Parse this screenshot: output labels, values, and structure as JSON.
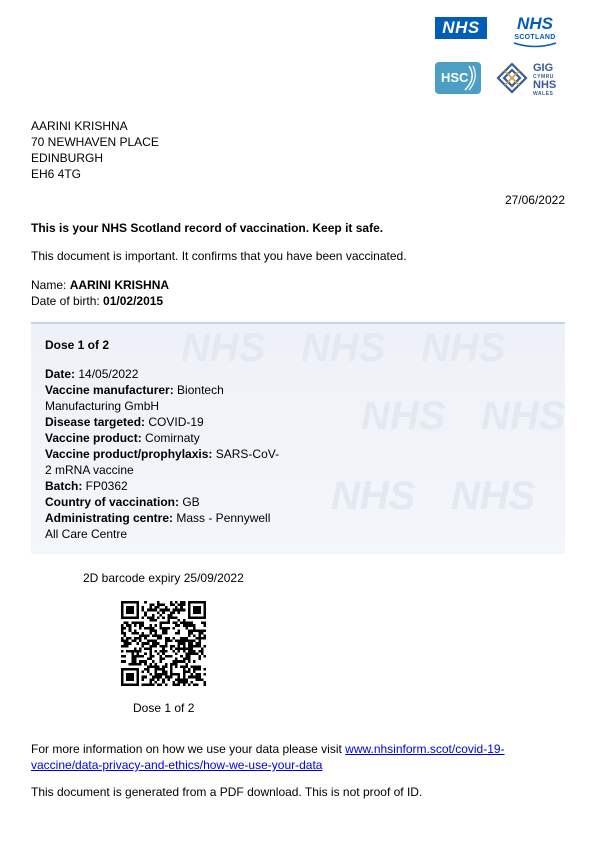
{
  "logos": {
    "nhs": "NHS",
    "nhs_scotland_main": "NHS",
    "nhs_scotland_sub": "SCOTLAND",
    "hsc": "HSC",
    "wales_gig": "GIG",
    "wales_cymru": "CYMRU",
    "wales_nhs": "NHS",
    "wales_wales": "WALES"
  },
  "address": {
    "name": "AARINI KRISHNA",
    "line1": "70 NEWHAVEN PLACE",
    "city": "EDINBURGH",
    "postcode": "EH6 4TG"
  },
  "date": "27/06/2022",
  "headline": "This is your NHS Scotland record of vaccination. Keep it safe.",
  "intro": "This document is important. It confirms that you have been vaccinated.",
  "person": {
    "name_label": "Name: ",
    "name": "AARINI KRISHNA",
    "dob_label": "Date of birth: ",
    "dob": "01/02/2015"
  },
  "dose": {
    "title": "Dose 1 of 2",
    "fields": [
      {
        "label": "Date:",
        "value": " 14/05/2022"
      },
      {
        "label": "Vaccine manufacturer:",
        "value": " Biontech Manufacturing GmbH"
      },
      {
        "label": "Disease targeted:",
        "value": " COVID-19"
      },
      {
        "label": "Vaccine product:",
        "value": " Comirnaty"
      },
      {
        "label": "Vaccine product/prophylaxis:",
        "value": " SARS-CoV-2 mRNA vaccine"
      },
      {
        "label": "Batch:",
        "value": " FP0362"
      },
      {
        "label": "Country of vaccination:",
        "value": " GB"
      },
      {
        "label": "Administrating centre:",
        "value": " Mass - Pennywell All Care Centre"
      }
    ],
    "watermark": "NHS"
  },
  "barcode": {
    "expiry": "2D barcode expiry 25/09/2022",
    "caption": "Dose 1 of 2",
    "icon": "qr-code-icon"
  },
  "info": {
    "text": "For more information on how we use your data please visit ",
    "link": "www.nhsinform.scot/covid-19-vaccine/data-privacy-and-ethics/how-we-use-your-data"
  },
  "footer_note": "This document is generated from a PDF download. This is not proof of ID.",
  "colors": {
    "nhs_blue": "#005eb8",
    "hsc_blue": "#4b9fc4",
    "wales_blue": "#3a5a95",
    "link": "#0000ee"
  }
}
